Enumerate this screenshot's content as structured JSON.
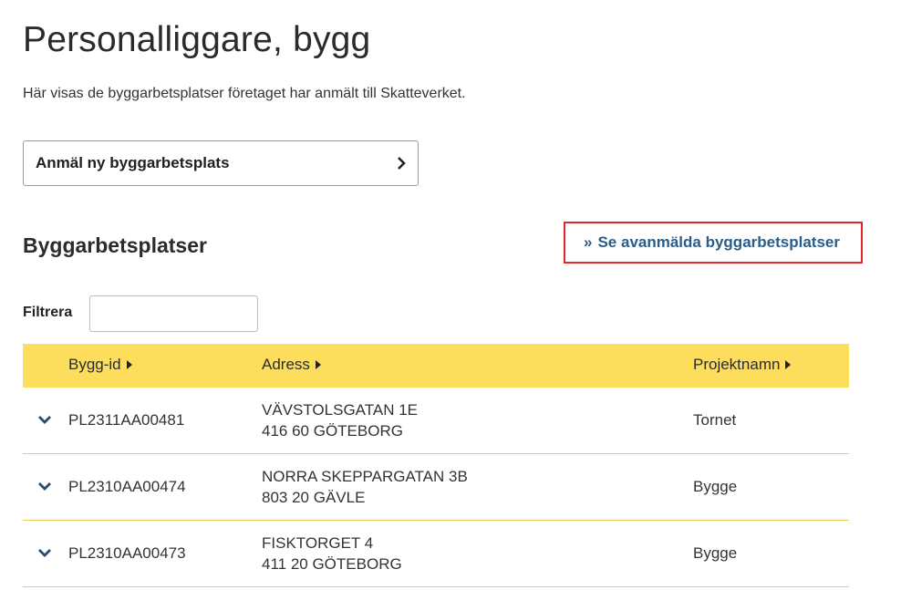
{
  "header": {
    "title": "Personalliggare, bygg",
    "intro": "Här visas de byggarbetsplatser företaget har anmält till Skatteverket."
  },
  "actions": {
    "new_site_label": "Anmäl ny byggarbetsplats",
    "deregistered_link": "Se avanmälda byggarbetsplatser"
  },
  "section": {
    "title": "Byggarbetsplatser"
  },
  "filter": {
    "label": "Filtrera",
    "value": ""
  },
  "table": {
    "columns": [
      "Bygg-id",
      "Adress",
      "Projektnamn"
    ],
    "rows": [
      {
        "id": "PL2311AA00481",
        "street": "VÄVSTOLSGATAN 1E",
        "postal": "416 60 GÖTEBORG",
        "project": "Tornet"
      },
      {
        "id": "PL2310AA00474",
        "street": "NORRA SKEPPARGATAN 3B",
        "postal": "803 20 GÄVLE",
        "project": "Bygge"
      },
      {
        "id": "PL2310AA00473",
        "street": "FISKTORGET 4",
        "postal": "411 20 GÖTEBORG",
        "project": "Bygge"
      }
    ]
  },
  "colors": {
    "accent": "#fddd5c",
    "link": "#2b5c8a",
    "highlight": "#e0262f"
  }
}
